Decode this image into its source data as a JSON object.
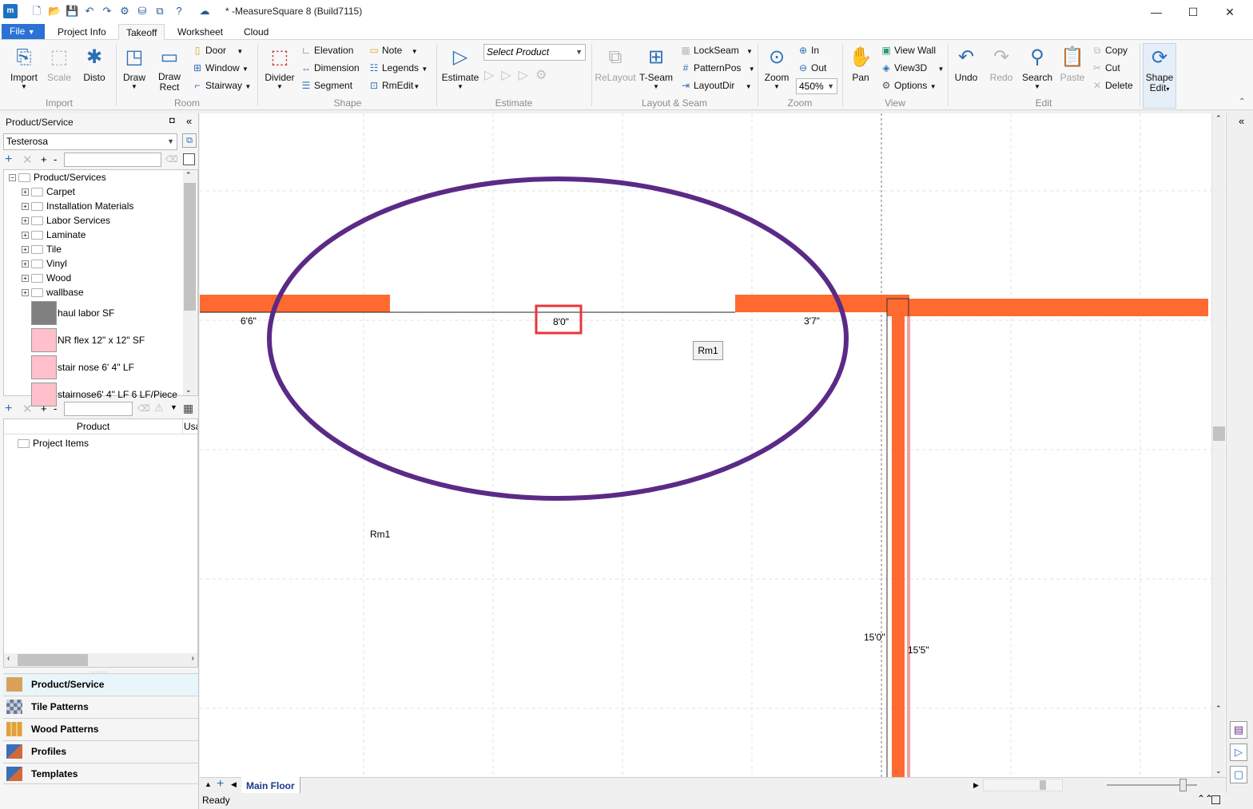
{
  "titlebar": {
    "app_icon": "m",
    "title": "* -MeasureSquare 8 (Build7115)",
    "minimize": "—",
    "maximize": "☐",
    "close": "✕"
  },
  "menu": {
    "file": "File",
    "tabs": [
      "Project Info",
      "Takeoff",
      "Worksheet",
      "Cloud"
    ]
  },
  "ribbon": {
    "import": {
      "import": "Import",
      "scale": "Scale",
      "disto": "Disto",
      "group": "Import"
    },
    "room": {
      "draw": "Draw",
      "draw_rect": "Draw\nRect",
      "door": "Door",
      "window": "Window",
      "stairway": "Stairway",
      "group": "Room"
    },
    "shape": {
      "divider": "Divider",
      "elevation": "Elevation",
      "dimension": "Dimension",
      "segment": "Segment",
      "note": "Note",
      "legends": "Legends",
      "rmedit": "RmEdit",
      "group": "Shape"
    },
    "estimate": {
      "estimate": "Estimate",
      "select_product": "Select Product",
      "group": "Estimate"
    },
    "layout": {
      "relayout": "ReLayout",
      "tseam": "T-Seam",
      "lockseam": "LockSeam",
      "patternpos": "PatternPos",
      "layoutdir": "LayoutDir",
      "group": "Layout & Seam"
    },
    "zoom": {
      "zoom": "Zoom",
      "in": "In",
      "out": "Out",
      "level": "450%",
      "group": "Zoom"
    },
    "view": {
      "pan": "Pan",
      "view_wall": "View Wall",
      "view3d": "View3D",
      "options": "Options",
      "group": "View"
    },
    "edit": {
      "undo": "Undo",
      "redo": "Redo",
      "search": "Search",
      "paste": "Paste",
      "copy": "Copy",
      "cut": "Cut",
      "delete": "Delete",
      "group": "Edit"
    },
    "shape_edit": {
      "label": "Shape\nEdit"
    }
  },
  "left_panel": {
    "header": "Product/Service",
    "pin": "◘",
    "collapse": "«",
    "dropdown": "Testerosa",
    "tree_root": "Product/Services",
    "folders": [
      "Carpet",
      "Installation Materials",
      "Labor Services",
      "Laminate",
      "Tile",
      "Vinyl",
      "Wood",
      "wallbase"
    ],
    "products": [
      {
        "label": "haul labor  SF",
        "color": "#808080"
      },
      {
        "label": "NR flex 12\" x 12\" SF",
        "color": "#ffc0cb"
      },
      {
        "label": "stair nose 6' 4\" LF",
        "color": "#ffc0cb"
      },
      {
        "label": "stairnose6' 4\" LF 6 LF/Piece",
        "color": "#ffc0cb"
      }
    ],
    "grid_headers": [
      "Product",
      "Usa"
    ],
    "project_items": "Project Items",
    "nav": [
      "Product/Service",
      "Tile Patterns",
      "Wood Patterns",
      "Profiles",
      "Templates"
    ]
  },
  "canvas": {
    "dim_left": "6'6\"",
    "dim_center": "8'0\"",
    "dim_right": "3'7\"",
    "room_tag": "Rm1",
    "room_label": "Rm1",
    "dim_v1": "15'0\"",
    "dim_v2": "15'5\"",
    "wall_color": "#ff6a30",
    "ellipse_color": "#5b2a86",
    "highlight_color": "#e8363c"
  },
  "bottom": {
    "floor_tab": "Main Floor",
    "status": "Ready"
  }
}
